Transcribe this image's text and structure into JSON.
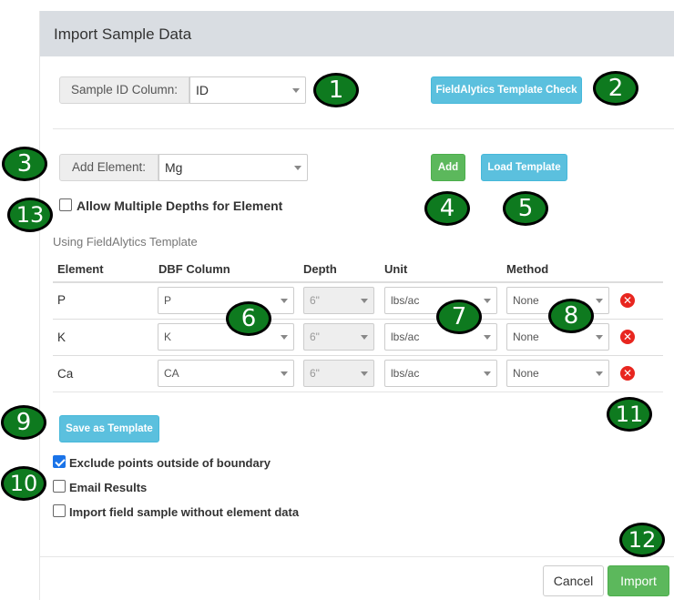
{
  "modal": {
    "title": "Import Sample Data"
  },
  "sample_id": {
    "label": "Sample ID Column:",
    "value": "ID"
  },
  "template_check_label": "FieldAlytics Template Check",
  "add_element": {
    "label": "Add Element:",
    "value": "Mg",
    "add_label": "Add",
    "load_template_label": "Load Template"
  },
  "allow_multiple_depths_label": "Allow Multiple Depths for Element",
  "template_note": "Using FieldAlytics Template",
  "table": {
    "headers": [
      "Element",
      "DBF Column",
      "Depth",
      "Unit",
      "Method"
    ],
    "rows": [
      {
        "element": "P",
        "dbf": "P",
        "depth": "6\"",
        "unit": "lbs/ac",
        "method": "None"
      },
      {
        "element": "K",
        "dbf": "K",
        "depth": "6\"",
        "unit": "lbs/ac",
        "method": "None"
      },
      {
        "element": "Ca",
        "dbf": "CA",
        "depth": "6\"",
        "unit": "lbs/ac",
        "method": "None"
      }
    ]
  },
  "save_template_label": "Save as Template",
  "options": {
    "exclude_points": {
      "label": "Exclude points outside of boundary",
      "checked": true
    },
    "email_results": {
      "label": "Email Results",
      "checked": false
    },
    "import_without_data": {
      "label": "Import field sample without element data",
      "checked": false
    }
  },
  "footer": {
    "cancel_label": "Cancel",
    "import_label": "Import"
  },
  "callouts": [
    "1",
    "2",
    "3",
    "4",
    "5",
    "6",
    "7",
    "8",
    "9",
    "10",
    "11",
    "12",
    "13"
  ],
  "colors": {
    "header_bg": "#d9dde2",
    "info": "#5bc0de",
    "success": "#5cb85c",
    "callout": "#0e7a1f",
    "danger": "#e8261f"
  }
}
